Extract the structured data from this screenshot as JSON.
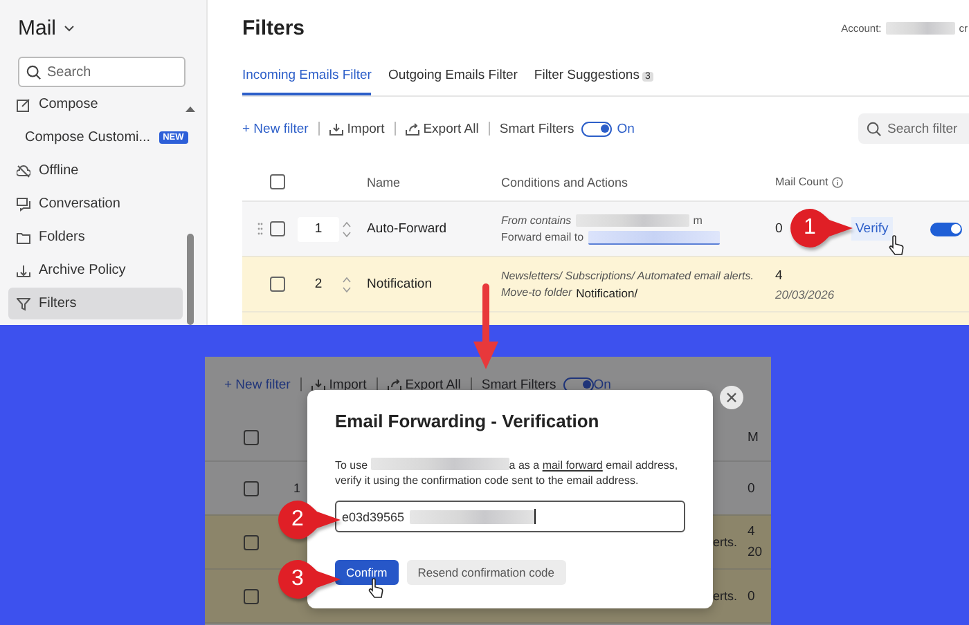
{
  "sidebar": {
    "title": "Mail",
    "search": {
      "placeholder": "Search"
    },
    "items": [
      {
        "label": "Compose",
        "selected": false
      },
      {
        "label": "Compose Customi...",
        "badge": "NEW",
        "selected": false
      },
      {
        "label": "Offline",
        "selected": false
      },
      {
        "label": "Conversation",
        "selected": false
      },
      {
        "label": "Folders",
        "selected": false
      },
      {
        "label": "Archive Policy",
        "selected": false
      },
      {
        "label": "Filters",
        "selected": true
      }
    ]
  },
  "page": {
    "title": "Filters",
    "account_label": "Account:",
    "account_tail": "cr"
  },
  "tabs": [
    {
      "label": "Incoming Emails Filter",
      "selected": true
    },
    {
      "label": "Outgoing Emails Filter",
      "selected": false
    },
    {
      "label": "Filter Suggestions",
      "count": "3",
      "selected": false
    }
  ],
  "toolbar": {
    "actions": [
      "+ New filter",
      "Import",
      "Export All"
    ],
    "smart_filters": {
      "label": "Smart Filters",
      "on": true,
      "state_label": "On"
    },
    "search": {
      "placeholder": "Search filter"
    }
  },
  "table": {
    "all_checked": false,
    "columns": [
      "Name",
      "Conditions and Actions",
      "Mail Count"
    ],
    "rows": [
      {
        "kind": "forward",
        "order": "1",
        "name": "Auto-Forward",
        "condition": "From contains",
        "condition_tail": "m",
        "action": "Forward email to",
        "count": "0",
        "link": "Verify",
        "enabled": true,
        "highlighted": false,
        "checked": false
      },
      {
        "kind": "move",
        "order": "2",
        "name": "Notification",
        "condition": "Newsletters/ Subscriptions/ Automated email alerts.",
        "action": "Move-to folder",
        "action_value": "Notification/",
        "count": "4",
        "date": "20/03/2026",
        "highlighted": true,
        "checked": false
      }
    ]
  },
  "background": {
    "all_checked": false,
    "toolbar": {
      "actions": [
        "+ New filter",
        "Import",
        "Export All"
      ],
      "smart_filters": {
        "label": "Smart Filters",
        "on": true,
        "state_label": "On"
      }
    },
    "column_tail": "M",
    "rows": [
      {
        "order": "1",
        "count": "0",
        "highlighted": false,
        "checked": false
      },
      {
        "condition_tail": "erts.",
        "count": "4",
        "date": "20",
        "highlighted": true,
        "checked": false
      },
      {
        "condition_tail": "erts.",
        "count": "0",
        "highlighted": true,
        "checked": false
      }
    ]
  },
  "dialog": {
    "title": "Email Forwarding - Verification",
    "message_start": "To use",
    "message_rest": "a as a",
    "link": "mail forward",
    "message_end": "email address, verify it using the confirmation code sent to the email address.",
    "code": {
      "value": "e03d39565"
    },
    "buttons": [
      {
        "label": "Confirm",
        "kind": "primary"
      },
      {
        "label": "Resend confirmation code",
        "kind": "secondary"
      }
    ]
  },
  "callouts": [
    {
      "number": "1"
    },
    {
      "number": "2"
    },
    {
      "number": "3"
    }
  ]
}
